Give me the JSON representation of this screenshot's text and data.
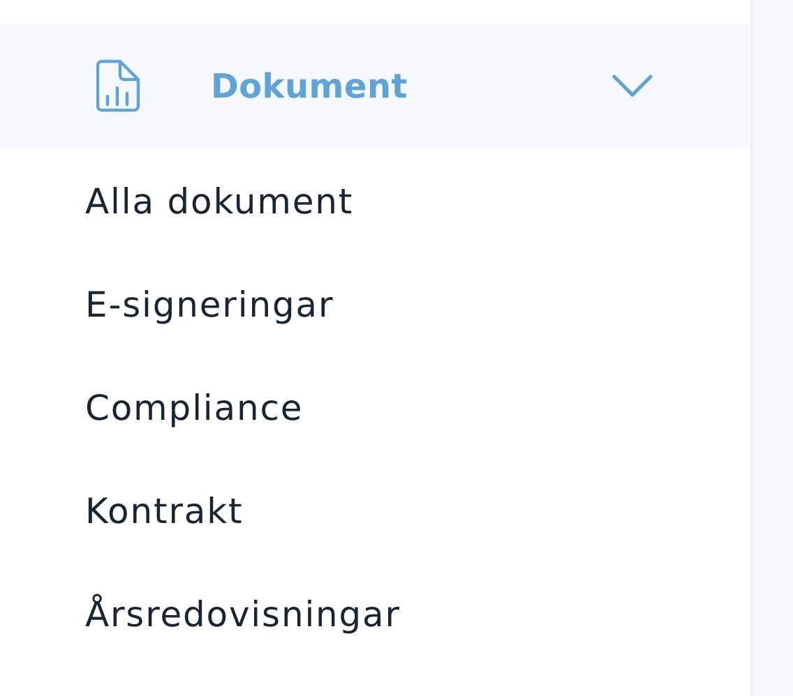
{
  "menu": {
    "title": "Dokument",
    "expanded": true,
    "items": [
      {
        "label": "Alla dokument"
      },
      {
        "label": "E-signeringar"
      },
      {
        "label": "Compliance"
      },
      {
        "label": "Kontrakt"
      },
      {
        "label": "Årsredovisningar"
      }
    ]
  }
}
